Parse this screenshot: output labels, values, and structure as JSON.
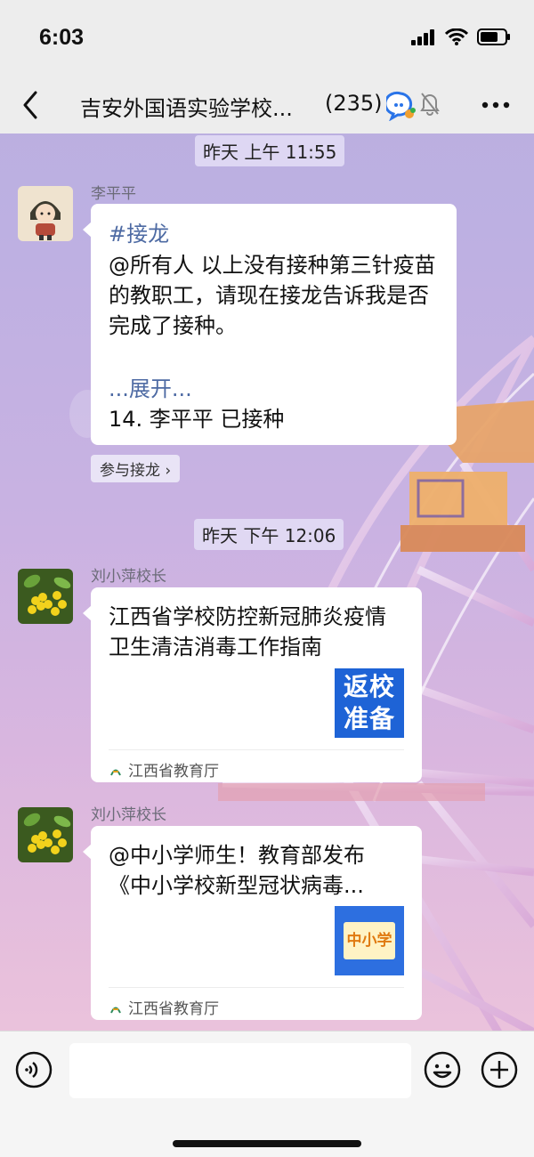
{
  "status_bar": {
    "time": "6:03"
  },
  "nav": {
    "title": "吉安外国语实验学校...",
    "member_count": "(235)"
  },
  "messages": [
    {
      "timestamp": "昨天 上午 11:55",
      "sender": "李平平",
      "type": "solitaire",
      "tag": "#接龙",
      "body": "@所有人 以上没有接种第三针疫苗的教职工，请现在接龙告诉我是否完成了接种。",
      "expand_label": "...展开...",
      "entry": "14. 李平平 已接种",
      "join_label": "参与接龙 ›"
    },
    {
      "timestamp": "昨天 下午 12:06",
      "sender": "刘小萍校长",
      "type": "link",
      "title": "江西省学校防控新冠肺炎疫情卫生清洁消毒工作指南",
      "thumb_text": "返校准备",
      "source": "江西省教育厅"
    },
    {
      "sender": "刘小萍校长",
      "type": "link",
      "title": "@中小学师生！教育部发布《中小学校新型冠状病毒...",
      "thumb_text": "中小学",
      "source": "江西省教育厅"
    }
  ],
  "input": {
    "placeholder": ""
  },
  "colors": {
    "link_blue": "#4d6aa3",
    "bubble": "#ffffff",
    "thumb_blue": "#1e63d6"
  },
  "icons": [
    "back-arrow-icon",
    "group-chat-icon",
    "mute-bell-icon",
    "more-icon",
    "voice-icon",
    "emoji-icon",
    "plus-icon",
    "signal-icon",
    "wifi-icon",
    "battery-icon",
    "source-logo-icon"
  ]
}
